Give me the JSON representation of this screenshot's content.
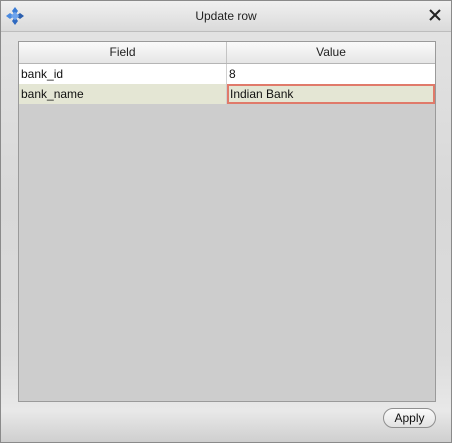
{
  "window": {
    "title": "Update row",
    "app_icon": "app-logo-icon",
    "close_icon": "close-icon"
  },
  "table": {
    "columns": [
      "Field",
      "Value"
    ],
    "rows": [
      {
        "field": "bank_id",
        "value": "8",
        "selected": false
      },
      {
        "field": "bank_name",
        "value": "Indian Bank",
        "selected": true,
        "editing": true
      }
    ]
  },
  "footer": {
    "apply_label": "Apply"
  },
  "colors": {
    "selected_row": "#e4e6d4",
    "editor_border": "#e07a6a"
  }
}
